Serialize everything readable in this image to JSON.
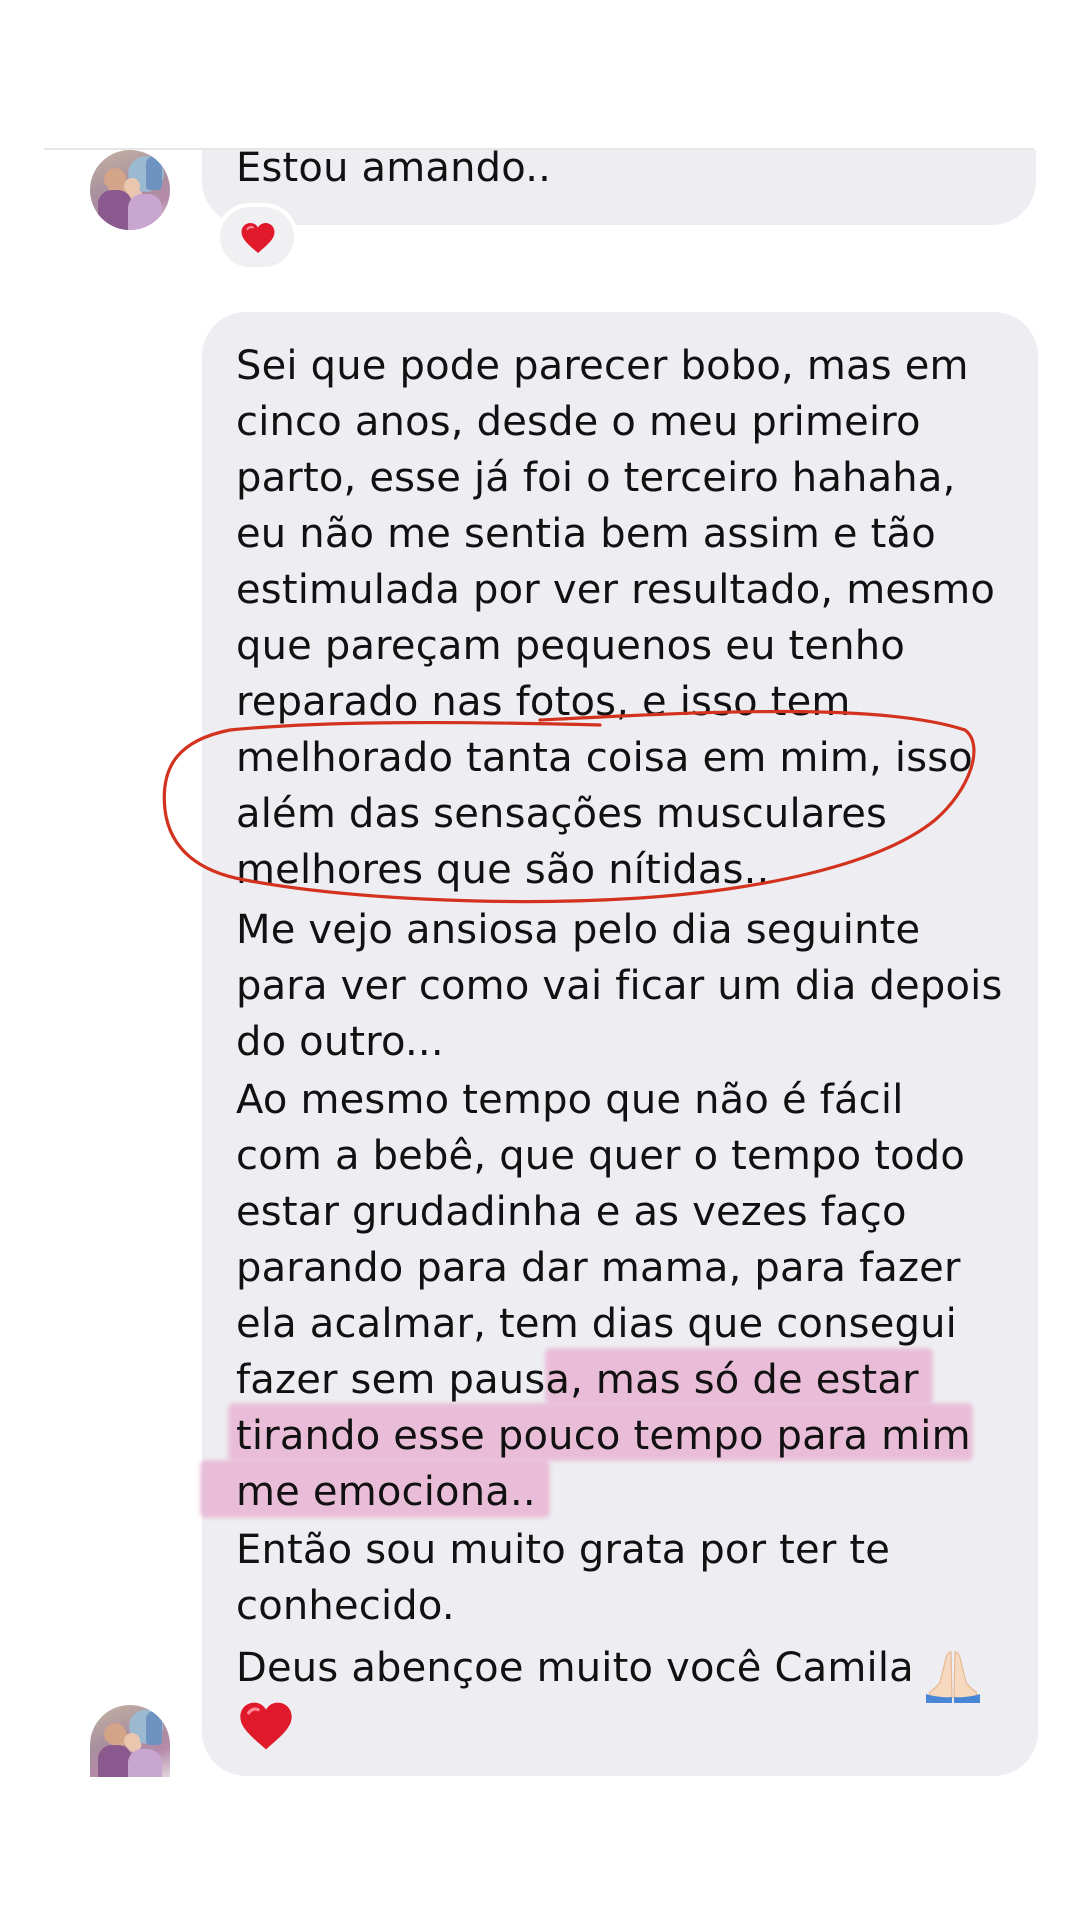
{
  "conversation": {
    "top_message": {
      "text": "Estou amando..",
      "reaction_icon": "red-heart-icon"
    },
    "main_message": {
      "lines_before_circle": [
        "Sei que pode parecer bobo, mas em",
        "cinco anos, desde o meu primeiro",
        "parto, esse já foi o terceiro hahaha,",
        "eu não me sentia bem assim e tão",
        "estimulada por ver resultado, mesmo",
        "que pareçam pequenos eu tenho",
        "reparado nas fotos, e isso tem"
      ],
      "lines_circled": [
        "melhorado tanta coisa em mim, isso",
        "além das sensações musculares",
        "melhores que são nítidas.."
      ],
      "lines_after_circle": [
        "Me vejo ansiosa pelo dia seguinte",
        "para ver como vai ficar um dia depois",
        "do outro...",
        "Ao mesmo tempo que não é fácil",
        "com a bebê, que quer o tempo todo",
        "estar grudadinha e as vezes faço",
        "parando para dar mama, para fazer",
        "ela acalmar, tem dias que consegui"
      ],
      "lines_highlighted": [
        "fazer sem pausa, mas só de estar",
        "tirando esse pouco tempo para mim",
        "me emociona.."
      ],
      "lines_end": [
        "Então sou muito grata por ter te",
        "conhecido."
      ],
      "last_line": "Deus abençoe muito você Camila",
      "end_icons": [
        "praying-hands-icon",
        "red-heart-icon"
      ]
    },
    "colors": {
      "bubble": "#eeeef2",
      "text": "#111111",
      "circle_annotation": "#d2321e",
      "highlight": "#e8aacd",
      "heart": "#e0192b"
    }
  }
}
